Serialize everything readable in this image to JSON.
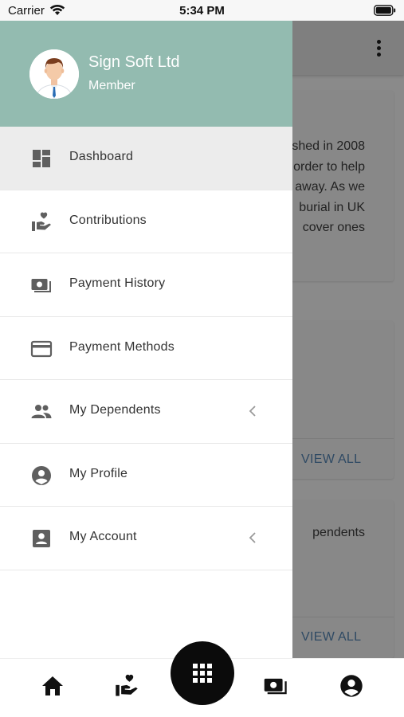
{
  "status_bar": {
    "carrier": "Carrier",
    "time": "5:34 PM"
  },
  "drawer": {
    "user_name": "Sign Soft Ltd",
    "user_role": "Member",
    "items": [
      {
        "label": "Dashboard",
        "icon": "dashboard-icon",
        "active": true,
        "expandable": false
      },
      {
        "label": "Contributions",
        "icon": "hand-heart-icon",
        "active": false,
        "expandable": false
      },
      {
        "label": "Payment History",
        "icon": "payments-icon",
        "active": false,
        "expandable": false
      },
      {
        "label": "Payment Methods",
        "icon": "credit-card-icon",
        "active": false,
        "expandable": false
      },
      {
        "label": "My Dependents",
        "icon": "people-icon",
        "active": false,
        "expandable": true
      },
      {
        "label": "My Profile",
        "icon": "account-circle-icon",
        "active": false,
        "expandable": false
      },
      {
        "label": "My Account",
        "icon": "account-box-icon",
        "active": false,
        "expandable": true
      }
    ]
  },
  "background": {
    "card1_lines": [
      "shed in 2008",
      "order to help",
      "away. As we",
      "burial in UK",
      "cover ones"
    ],
    "card2_action": "VIEW ALL",
    "card3_text": "pendents",
    "card3_action": "VIEW ALL"
  },
  "bottom_nav": {
    "items": [
      "home-icon",
      "hand-heart-icon",
      "apps-grid-icon",
      "payments-icon",
      "account-circle-icon"
    ]
  },
  "colors": {
    "header": "#93bbb0",
    "active_item": "#ececec",
    "fab": "#0b0b0b",
    "link": "#2f4a64"
  }
}
